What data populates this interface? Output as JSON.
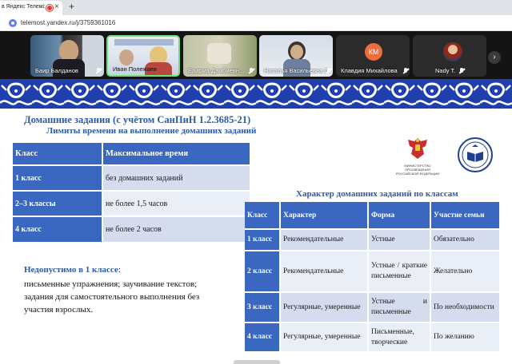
{
  "browser": {
    "tab_title": "в Яндекс Телемост",
    "url": "telemost.yandex.ru/j/3759361016"
  },
  "participants": [
    {
      "name": "Баир Балданов"
    },
    {
      "name": "Иван Полежаев"
    },
    {
      "name": "Баирма Дамбиевн..."
    },
    {
      "name": "Наталья Васильевна С..."
    },
    {
      "name": "Клавдия Михайлова",
      "initials": "КМ"
    },
    {
      "name": "Nady T."
    }
  ],
  "colors": {
    "accent": "#3a67bf",
    "heading": "#2d5aa8",
    "ornament": "#1f3fae",
    "avatar_km": "#ef6c3b"
  },
  "slide": {
    "title": "Домашние задания (с учётом СанПиН 1.2.3685-21)",
    "subtitle": "Лимиты времени на выполнение домашних заданий",
    "limits_table": {
      "headers": [
        "Класс",
        "Максимальное время"
      ],
      "rows": [
        [
          "1 класс",
          "без домашних заданий"
        ],
        [
          "2–3 классы",
          "не более 1,5 часов"
        ],
        [
          "4 класс",
          "не более 2 часов"
        ]
      ]
    },
    "ministry_caption": "МИНИСТЕРСТВО ПРОСВЕЩЕНИЯ РОССИЙСКОЙ ФЕДЕРАЦИИ",
    "kinds_title": "Характер домашних заданий по классам",
    "kinds_table": {
      "headers": [
        "Класс",
        "Характер",
        "Форма",
        "Участие семьи"
      ],
      "rows": [
        [
          "1 класс",
          "Рекомендательные",
          "Устные",
          "Обязательно"
        ],
        [
          "2 класс",
          "Рекомендательные",
          "Устные / краткие письменные",
          "Желательно"
        ],
        [
          "3 класс",
          "Регулярные, умеренные",
          "Устные и письменные",
          "По необходимости"
        ],
        [
          "4 класс",
          "Регулярные, умеренные",
          "Письменные, творческие",
          "По желанию"
        ]
      ]
    },
    "forbidden": {
      "heading": "Недопустимо в 1 классе",
      "lines": [
        "письменные упражнения; заучивание текстов;",
        "задания для самостоятельного выполнения без",
        "участия взрослых."
      ]
    }
  }
}
